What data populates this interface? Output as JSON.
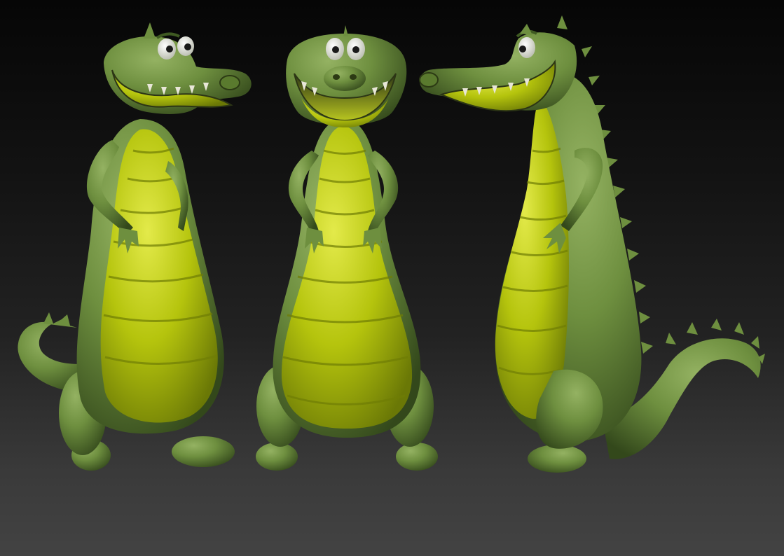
{
  "scene": {
    "subject_count": 3,
    "views": [
      "three-quarter-left",
      "front",
      "side-right"
    ]
  },
  "colors": {
    "background_top": "#060606",
    "background_bottom": "#434343",
    "skin": "#6e8f3f",
    "skin_shadow": "#3f5a22",
    "skin_highlight": "#8fae5a",
    "belly": "#b9c60e",
    "belly_shadow": "#7b8a08",
    "belly_highlight": "#dde63a",
    "teeth": "#e8e6d8",
    "eye_white": "#e9eadf",
    "pupil": "#1a1a1a"
  }
}
